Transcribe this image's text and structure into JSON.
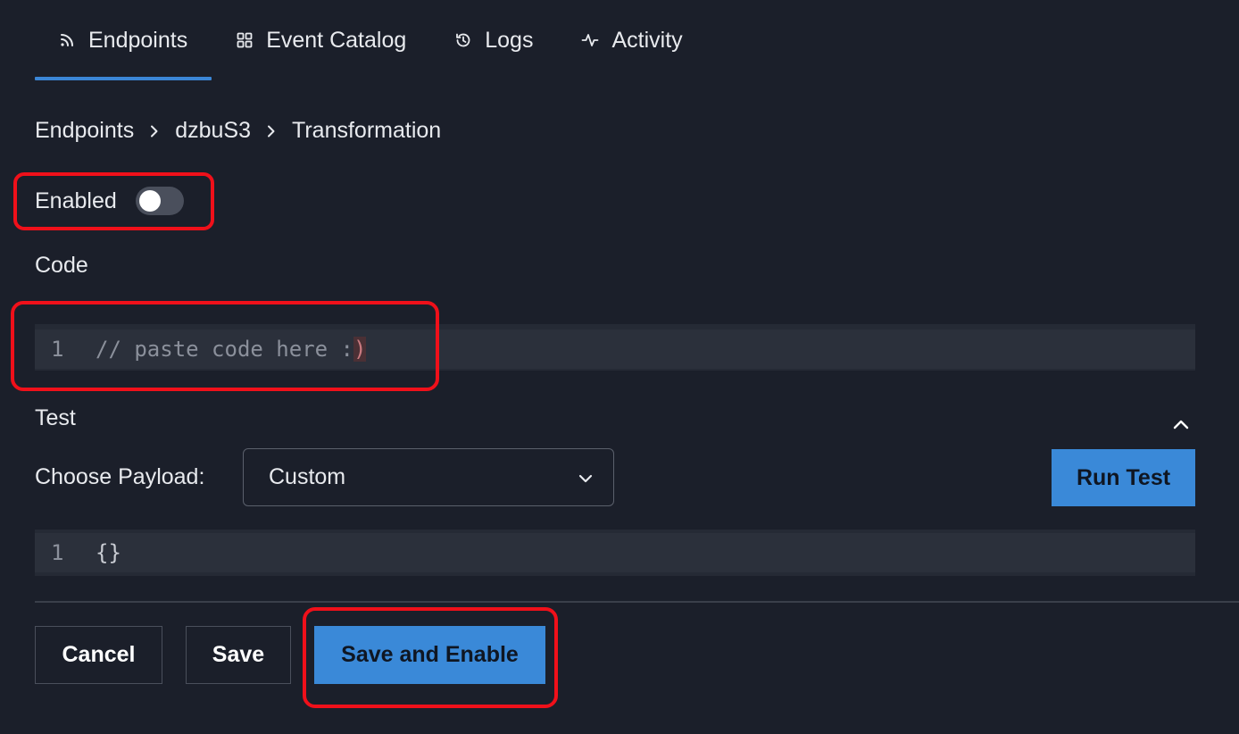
{
  "tabs": [
    {
      "label": "Endpoints",
      "icon": "rss-icon",
      "active": true
    },
    {
      "label": "Event Catalog",
      "icon": "grid-icon",
      "active": false
    },
    {
      "label": "Logs",
      "icon": "history-icon",
      "active": false
    },
    {
      "label": "Activity",
      "icon": "activity-icon",
      "active": false
    }
  ],
  "breadcrumb": [
    "Endpoints",
    "dzbuS3",
    "Transformation"
  ],
  "enabled": {
    "label": "Enabled",
    "checked": false
  },
  "code_section": {
    "label": "Code",
    "line_number": "1",
    "code_text": "// paste code here :",
    "code_paren": ")"
  },
  "test_section": {
    "label": "Test",
    "payload_label": "Choose Payload:",
    "payload_value": "Custom",
    "run_test_label": "Run Test",
    "line_number": "1",
    "payload_code": "{}"
  },
  "actions": {
    "cancel_label": "Cancel",
    "save_label": "Save",
    "save_enable_label": "Save and Enable"
  },
  "colors": {
    "background": "#1b1f2a",
    "accent": "#3a89d8",
    "annotation": "#f0101a"
  }
}
